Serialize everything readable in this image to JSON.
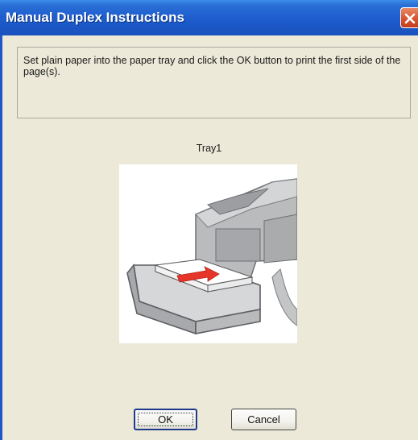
{
  "window": {
    "title": "Manual Duplex Instructions",
    "close_icon": "close-icon",
    "titlebar_color": "#1f5fcf",
    "close_color": "#d9532f"
  },
  "message": {
    "text": "Set plain paper into the paper tray and click the OK button to print the first side of the page(s)."
  },
  "illustration": {
    "label": "Tray1",
    "icon": "printer-tray-illustration",
    "arrow_color": "#e8352a"
  },
  "buttons": {
    "ok_label": "OK",
    "cancel_label": "Cancel"
  }
}
